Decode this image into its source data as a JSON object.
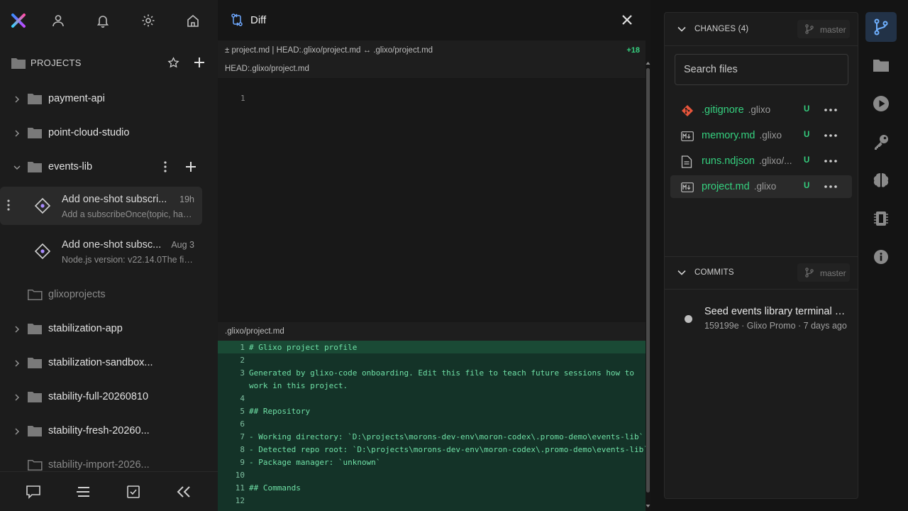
{
  "sidebar": {
    "projects_label": "PROJECTS",
    "projects": [
      {
        "name": "payment-api"
      },
      {
        "name": "point-cloud-studio"
      },
      {
        "name": "events-lib"
      },
      {
        "name": "glixoprojects"
      },
      {
        "name": "stabilization-app"
      },
      {
        "name": "stabilization-sandbox..."
      },
      {
        "name": "stability-full-20260810"
      },
      {
        "name": "stability-fresh-20260..."
      },
      {
        "name": "stability-import-2026..."
      }
    ],
    "sessions": [
      {
        "title": "Add one-shot subscri...",
        "time": "19h",
        "subtitle": "Add a subscribeOnce(topic, han..."
      },
      {
        "title": "Add one-shot subsc...",
        "time": "Aug 3",
        "subtitle": "Node.js version: v22.14.0The firs..."
      }
    ]
  },
  "diff": {
    "title": "Diff",
    "path_bar": "±  project.md  |  HEAD:.glixo/project.md  ↔  .glixo/project.md",
    "added_count": "+18",
    "old_label": "HEAD:.glixo/project.md",
    "old_line_number": "1",
    "new_label": ".glixo/project.md",
    "lines": [
      {
        "n": "1",
        "t": "# Glixo project profile"
      },
      {
        "n": "2",
        "t": ""
      },
      {
        "n": "3",
        "t": "Generated by glixo-code onboarding. Edit this file to teach future sessions how to"
      },
      {
        "n": "",
        "t": "work in this project."
      },
      {
        "n": "4",
        "t": ""
      },
      {
        "n": "5",
        "t": "## Repository"
      },
      {
        "n": "6",
        "t": ""
      },
      {
        "n": "7",
        "t": "- Working directory: `D:\\projects\\morons-dev-env\\moron-codex\\.promo-demo\\events-lib`"
      },
      {
        "n": "8",
        "t": "- Detected repo root: `D:\\projects\\morons-dev-env\\moron-codex\\.promo-demo\\events-lib`"
      },
      {
        "n": "9",
        "t": "- Package manager: `unknown`"
      },
      {
        "n": "10",
        "t": ""
      },
      {
        "n": "11",
        "t": "## Commands"
      },
      {
        "n": "12",
        "t": ""
      }
    ]
  },
  "git": {
    "changes_label": "CHANGES (4)",
    "branch": "master",
    "search_placeholder": "Search files",
    "files": [
      {
        "name": ".gitignore",
        "dir": ".glixo",
        "status": "U",
        "icon": "git-icon"
      },
      {
        "name": "memory.md",
        "dir": ".glixo",
        "status": "U",
        "icon": "markdown-icon"
      },
      {
        "name": "runs.ndjson",
        "dir": ".glixo/...",
        "status": "U",
        "icon": "file-icon"
      },
      {
        "name": "project.md",
        "dir": ".glixo",
        "status": "U",
        "icon": "markdown-icon"
      }
    ],
    "commits_label": "COMMITS",
    "commits": [
      {
        "title": "Seed events library terminal d...",
        "meta": "159199e · Glixo Promo · 7 days ago"
      }
    ]
  },
  "colors": {
    "added": "#35d07f",
    "accent": "#4aa3ff",
    "added_bg": "#143328"
  }
}
